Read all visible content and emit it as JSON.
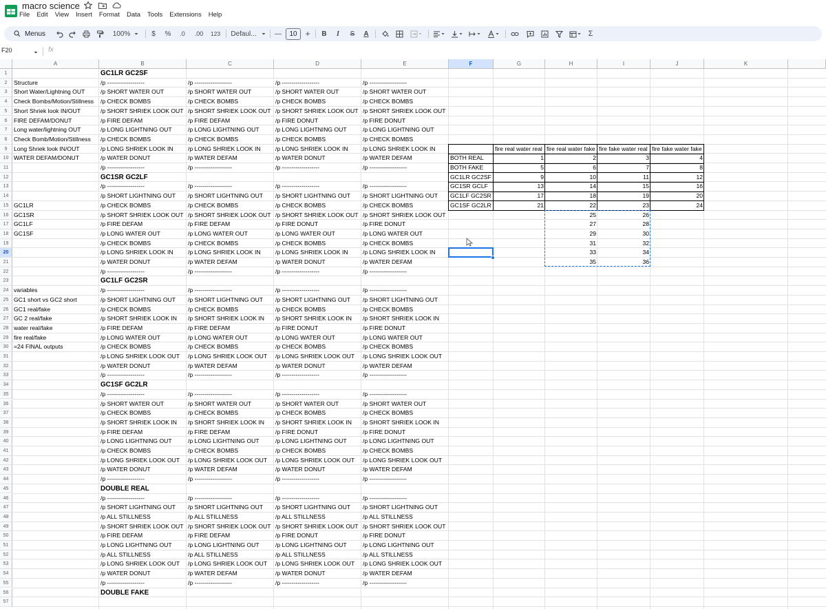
{
  "app": {
    "title": "macro science",
    "menus": [
      "File",
      "Edit",
      "View",
      "Insert",
      "Format",
      "Data",
      "Tools",
      "Extensions",
      "Help"
    ]
  },
  "toolbar": {
    "menus_label": "Menus",
    "zoom": "100%",
    "currency": "$",
    "percent": "%",
    "dec_decrease": ".0",
    "dec_increase": ".00",
    "number_format": "123",
    "font": "Defaul...",
    "font_size": "10",
    "minus": "—",
    "plus": "+",
    "bold": "B",
    "italic": "I",
    "strike": "S",
    "text_color": "A",
    "sigma": "Σ"
  },
  "formula_bar": {
    "name_box": "F20",
    "fx": "fx",
    "value": ""
  },
  "sheet": {
    "columns": [
      "A",
      "B",
      "C",
      "D",
      "E",
      "F",
      "G",
      "H",
      "I",
      "J",
      "K"
    ],
    "active_column": "F",
    "active_row": 20,
    "rows": [
      {
        "A": "",
        "B": "GC1LR GC2SF",
        "C": "",
        "D": "",
        "E": "",
        "bold": true
      },
      {
        "A": "Structure",
        "B": "/p -------------------",
        "C": "/p -------------------",
        "D": "/p -------------------",
        "E": "/p -------------------"
      },
      {
        "A": "Short Water/Lightning OUT",
        "B": "/p SHORT WATER OUT",
        "C": "/p SHORT WATER OUT",
        "D": "/p SHORT WATER OUT",
        "E": "/p SHORT WATER OUT"
      },
      {
        "A": "Check Bombs/Motion/Stillness",
        "B": "/p CHECK BOMBS",
        "C": "/p CHECK BOMBS",
        "D": "/p CHECK BOMBS",
        "E": "/p CHECK BOMBS"
      },
      {
        "A": "Short Shriek look IN/OUT",
        "B": "/p SHORT SHRIEK LOOK OUT",
        "C": "/p SHORT SHRIEK LOOK OUT",
        "D": "/p SHORT SHRIEK LOOK OUT",
        "E": "/p SHORT SHRIEK LOOK OUT"
      },
      {
        "A": "FIRE DEFAM/DONUT",
        "B": "/p FIRE DEFAM",
        "C": "/p FIRE DEFAM",
        "D": "/p FIRE DONUT",
        "E": "/p FIRE DONUT"
      },
      {
        "A": "Long water/lightning OUT",
        "B": "/p LONG LIGHTNING OUT",
        "C": "/p LONG LIGHTNING OUT",
        "D": "/p LONG LIGHTNING OUT",
        "E": "/p LONG LIGHTNING OUT"
      },
      {
        "A": "Check Bomb/Motion/Stillness",
        "B": "/p CHECK BOMBS",
        "C": "/p CHECK BOMBS",
        "D": "/p CHECK BOMBS",
        "E": "/p CHECK BOMBS"
      },
      {
        "A": "Long Shriek look IN/OUT",
        "B": "/p LONG SHRIEK LOOK IN",
        "C": "/p LONG SHRIEK LOOK IN",
        "D": "/p LONG SHRIEK LOOK IN",
        "E": "/p LONG SHRIEK LOOK IN"
      },
      {
        "A": "WATER DEFAM/DONUT",
        "B": "/p WATER DONUT",
        "C": "/p WATER DEFAM",
        "D": "/p WATER DONUT",
        "E": "/p WATER DEFAM"
      },
      {
        "A": "",
        "B": "/p -------------------",
        "C": "/p -------------------",
        "D": "/p -------------------",
        "E": "/p -------------------"
      },
      {
        "A": "",
        "B": "GC1SR GC2LF",
        "C": "",
        "D": "",
        "E": "",
        "bold": true
      },
      {
        "A": "",
        "B": "/p -------------------",
        "C": "/p -------------------",
        "D": "/p -------------------",
        "E": "/p -------------------"
      },
      {
        "A": "",
        "B": "/p SHORT LIGHTNING OUT",
        "C": "/p SHORT LIGHTNING OUT",
        "D": "/p SHORT LIGHTNING OUT",
        "E": "/p SHORT LIGHTNING OUT"
      },
      {
        "A": "GC1LR",
        "B": "/p CHECK BOMBS",
        "C": "/p CHECK BOMBS",
        "D": "/p CHECK BOMBS",
        "E": "/p CHECK BOMBS"
      },
      {
        "A": "GC1SR",
        "B": "/p SHORT SHRIEK LOOK OUT",
        "C": "/p SHORT SHRIEK LOOK OUT",
        "D": "/p SHORT SHRIEK LOOK OUT",
        "E": "/p SHORT SHRIEK LOOK OUT"
      },
      {
        "A": "GC1LF",
        "B": "/p FIRE DEFAM",
        "C": "/p FIRE DEFAM",
        "D": "/p FIRE DONUT",
        "E": "/p FIRE DONUT"
      },
      {
        "A": "GC1SF",
        "B": "/p LONG WATER OUT",
        "C": "/p LONG WATER OUT",
        "D": "/p LONG WATER OUT",
        "E": "/p LONG WATER OUT"
      },
      {
        "A": "",
        "B": "/p CHECK BOMBS",
        "C": "/p CHECK BOMBS",
        "D": "/p CHECK BOMBS",
        "E": "/p CHECK BOMBS"
      },
      {
        "A": "",
        "B": "/p LONG SHRIEK LOOK IN",
        "C": "/p LONG SHRIEK LOOK IN",
        "D": "/p LONG SHRIEK LOOK IN",
        "E": "/p LONG SHRIEK LOOK IN"
      },
      {
        "A": "",
        "B": "/p WATER DONUT",
        "C": "/p WATER DEFAM",
        "D": "/p WATER DONUT",
        "E": "/p WATER DEFAM"
      },
      {
        "A": "",
        "B": "/p -------------------",
        "C": "/p -------------------",
        "D": "/p -------------------",
        "E": "/p -------------------"
      },
      {
        "A": "",
        "B": "GC1LF GC2SR",
        "C": "",
        "D": "",
        "E": "",
        "bold": true
      },
      {
        "A": "variables",
        "B": "/p -------------------",
        "C": "/p -------------------",
        "D": "/p -------------------",
        "E": "/p -------------------"
      },
      {
        "A": "GC1 short vs GC2 short",
        "B": "/p SHORT LIGHTNING OUT",
        "C": "/p SHORT LIGHTNING OUT",
        "D": "/p SHORT LIGHTNING OUT",
        "E": "/p SHORT LIGHTNING OUT"
      },
      {
        "A": "GC1 real/fake",
        "B": "/p CHECK BOMBS",
        "C": "/p CHECK BOMBS",
        "D": "/p CHECK BOMBS",
        "E": "/p CHECK BOMBS"
      },
      {
        "A": "GC 2 real/fake",
        "B": "/p SHORT SHRIEK LOOK IN",
        "C": "/p SHORT SHRIEK LOOK IN",
        "D": "/p SHORT SHRIEK LOOK IN",
        "E": "/p SHORT SHRIEK LOOK IN"
      },
      {
        "A": "water real/fake",
        "B": "/p FIRE DEFAM",
        "C": "/p FIRE DEFAM",
        "D": "/p FIRE DONUT",
        "E": "/p FIRE DONUT"
      },
      {
        "A": "fire real/fake",
        "B": "/p LONG WATER OUT",
        "C": "/p LONG WATER OUT",
        "D": "/p LONG WATER OUT",
        "E": "/p LONG WATER OUT"
      },
      {
        "A": "=24 FINAL outputs",
        "B": "/p CHECK BOMBS",
        "C": "/p CHECK BOMBS",
        "D": "/p CHECK BOMBS",
        "E": "/p CHECK BOMBS"
      },
      {
        "A": "",
        "B": "/p LONG SHRIEK LOOK OUT",
        "C": "/p LONG SHRIEK LOOK OUT",
        "D": "/p LONG SHRIEK LOOK OUT",
        "E": "/p LONG SHRIEK LOOK OUT"
      },
      {
        "A": "",
        "B": "/p WATER DONUT",
        "C": "/p WATER DEFAM",
        "D": "/p WATER DONUT",
        "E": "/p WATER DEFAM"
      },
      {
        "A": "",
        "B": "/p -------------------",
        "C": "/p -------------------",
        "D": "/p -------------------",
        "E": "/p -------------------"
      },
      {
        "A": "",
        "B": "GC1SF GC2LR",
        "C": "",
        "D": "",
        "E": "",
        "bold": true
      },
      {
        "A": "",
        "B": "/p -------------------",
        "C": "/p -------------------",
        "D": "/p -------------------",
        "E": "/p -------------------"
      },
      {
        "A": "",
        "B": "/p SHORT WATER OUT",
        "C": "/p SHORT WATER OUT",
        "D": "/p SHORT WATER OUT",
        "E": "/p SHORT WATER OUT"
      },
      {
        "A": "",
        "B": "/p CHECK BOMBS",
        "C": "/p CHECK BOMBS",
        "D": "/p CHECK BOMBS",
        "E": "/p CHECK BOMBS"
      },
      {
        "A": "",
        "B": "/p SHORT SHRIEK LOOK IN",
        "C": "/p SHORT SHRIEK LOOK IN",
        "D": "/p SHORT SHRIEK LOOK IN",
        "E": "/p SHORT SHRIEK LOOK IN"
      },
      {
        "A": "",
        "B": "/p FIRE DEFAM",
        "C": "/p FIRE DEFAM",
        "D": "/p FIRE DONUT",
        "E": "/p FIRE DONUT"
      },
      {
        "A": "",
        "B": "/p LONG LIGHTNING OUT",
        "C": "/p LONG LIGHTNING OUT",
        "D": "/p LONG LIGHTNING OUT",
        "E": "/p LONG LIGHTNING OUT"
      },
      {
        "A": "",
        "B": "/p CHECK BOMBS",
        "C": "/p CHECK BOMBS",
        "D": "/p CHECK BOMBS",
        "E": "/p CHECK BOMBS"
      },
      {
        "A": "",
        "B": "/p LONG SHRIEK LOOK OUT",
        "C": "/p LONG SHRIEK LOOK OUT",
        "D": "/p LONG SHRIEK LOOK OUT",
        "E": "/p LONG SHRIEK LOOK OUT"
      },
      {
        "A": "",
        "B": "/p WATER DONUT",
        "C": "/p WATER DEFAM",
        "D": "/p WATER DONUT",
        "E": "/p WATER DEFAM"
      },
      {
        "A": "",
        "B": "/p -------------------",
        "C": "/p -------------------",
        "D": "/p -------------------",
        "E": "/p -------------------"
      },
      {
        "A": "",
        "B": "DOUBLE REAL",
        "C": "",
        "D": "",
        "E": "",
        "bold": true
      },
      {
        "A": "",
        "B": "/p -------------------",
        "C": "/p -------------------",
        "D": "/p -------------------",
        "E": "/p -------------------"
      },
      {
        "A": "",
        "B": "/p SHORT LIGHTNING OUT",
        "C": "/p SHORT LIGHTNING OUT",
        "D": "/p SHORT LIGHTNING OUT",
        "E": "/p SHORT LIGHTNING OUT"
      },
      {
        "A": "",
        "B": "/p ALL STILLNESS",
        "C": "/p ALL STILLNESS",
        "D": "/p ALL STILLNESS",
        "E": "/p ALL STILLNESS"
      },
      {
        "A": "",
        "B": "/p SHORT SHRIEK LOOK OUT",
        "C": "/p SHORT SHRIEK LOOK OUT",
        "D": "/p SHORT SHRIEK LOOK OUT",
        "E": "/p SHORT SHRIEK LOOK OUT"
      },
      {
        "A": "",
        "B": "/p FIRE DEFAM",
        "C": "/p FIRE DEFAM",
        "D": "/p FIRE DONUT",
        "E": "/p FIRE DONUT"
      },
      {
        "A": "",
        "B": "/p LONG LIGHTNING OUT",
        "C": "/p LONG LIGHTNING OUT",
        "D": "/p LONG LIGHTNING OUT",
        "E": "/p LONG LIGHTNING OUT"
      },
      {
        "A": "",
        "B": "/p ALL STILLNESS",
        "C": "/p ALL STILLNESS",
        "D": "/p ALL STILLNESS",
        "E": "/p ALL STILLNESS"
      },
      {
        "A": "",
        "B": "/p LONG SHRIEK LOOK OUT",
        "C": "/p LONG SHRIEK LOOK OUT",
        "D": "/p LONG SHRIEK LOOK OUT",
        "E": "/p LONG SHRIEK LOOK OUT"
      },
      {
        "A": "",
        "B": "/p WATER DONUT",
        "C": "/p WATER DEFAM",
        "D": "/p WATER DONUT",
        "E": "/p WATER DEFAM"
      },
      {
        "A": "",
        "B": "/p -------------------",
        "C": "/p -------------------",
        "D": "/p -------------------",
        "E": "/p -------------------"
      },
      {
        "A": "",
        "B": "DOUBLE FAKE",
        "C": "",
        "D": "",
        "E": "",
        "bold": true
      }
    ],
    "table": {
      "headers": [
        "fire real water real",
        "fire real water fake",
        "fire fake water real",
        "fire fake water fake"
      ],
      "rows": [
        {
          "label": "BOTH REAL",
          "values": [
            1,
            2,
            3,
            4
          ]
        },
        {
          "label": "BOTH FAKE",
          "values": [
            5,
            6,
            7,
            8
          ]
        },
        {
          "label": "GC1LR GC2SF",
          "values": [
            9,
            10,
            11,
            12
          ]
        },
        {
          "label": "GC1SR GCLF",
          "values": [
            13,
            14,
            15,
            16
          ]
        },
        {
          "label": "GC1LF GC2SR",
          "values": [
            17,
            18,
            19,
            20
          ]
        },
        {
          "label": "GC1SF GC2LR",
          "values": [
            21,
            22,
            23,
            24
          ]
        }
      ]
    },
    "extra": [
      {
        "row": 16,
        "H": 25,
        "I": 26
      },
      {
        "row": 17,
        "H": 27,
        "I": 28
      },
      {
        "row": 18,
        "H": 29,
        "I": 30
      },
      {
        "row": 19,
        "H": 31,
        "I": 32
      },
      {
        "row": 20,
        "H": 33,
        "I": 34
      },
      {
        "row": 21,
        "H": 35,
        "I": 36
      }
    ]
  },
  "colors": {
    "selection": "#1a73e8",
    "header_active": "#d3e3fd",
    "toolbar_bg": "#edf2fa"
  }
}
